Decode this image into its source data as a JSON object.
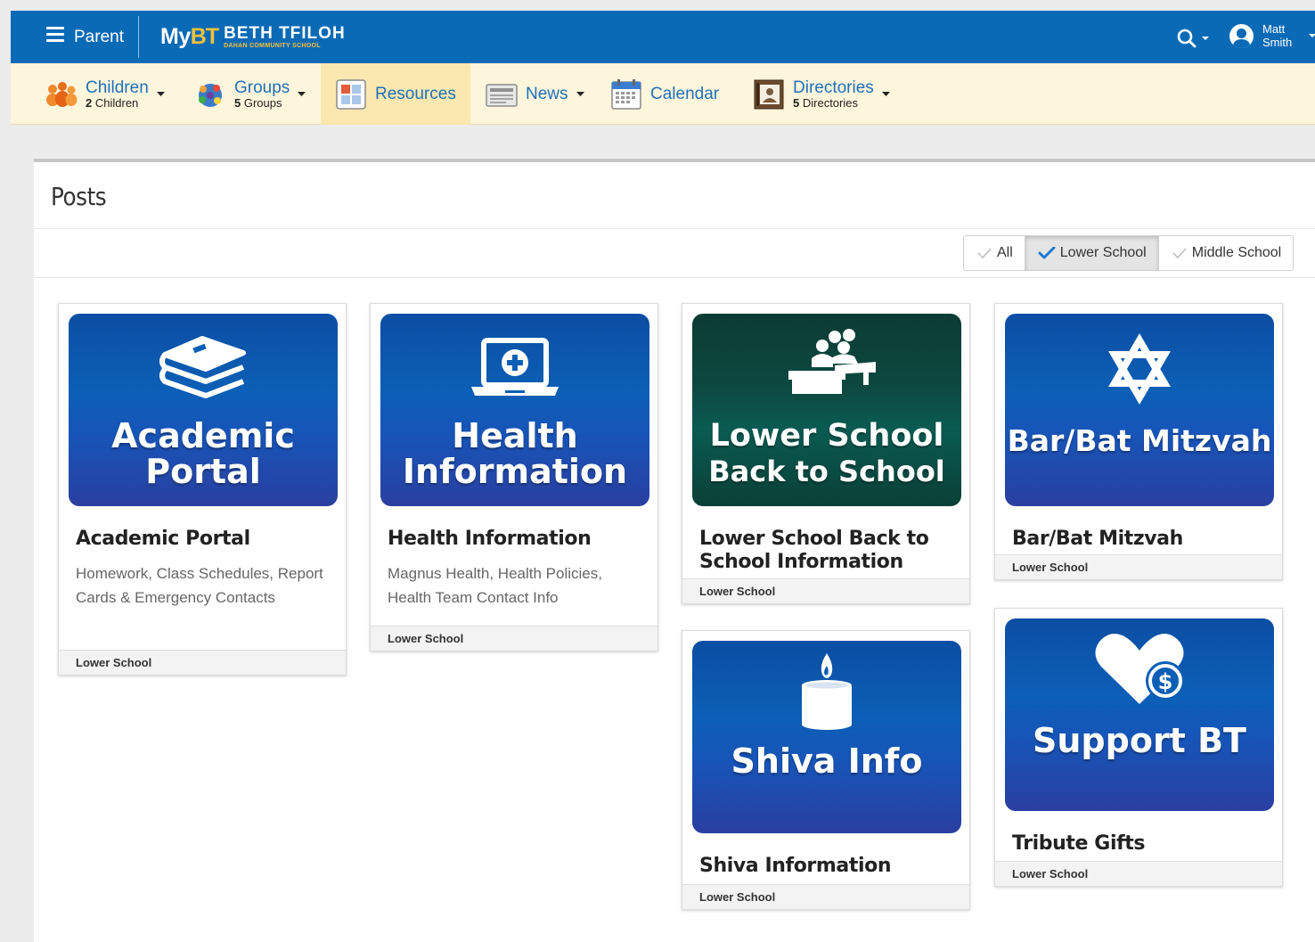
{
  "header": {
    "role": "Parent",
    "logo_prefix": "My",
    "logo_bt": "BT",
    "school_name": "BETH TFILOH",
    "school_sub": "DAHAN COMMUNITY SCHOOL",
    "user_first": "Matt",
    "user_last": "Smith"
  },
  "nav": {
    "children": {
      "label": "Children",
      "count": "2",
      "sub": "Children"
    },
    "groups": {
      "label": "Groups",
      "count": "5",
      "sub": "Groups"
    },
    "resources": {
      "label": "Resources"
    },
    "news": {
      "label": "News"
    },
    "calendar": {
      "label": "Calendar"
    },
    "directories": {
      "label": "Directories",
      "count": "5",
      "sub": "Directories"
    }
  },
  "page": {
    "title": "Posts"
  },
  "filters": {
    "all": "All",
    "lower": "Lower School",
    "middle": "Middle School",
    "selected": "Lower School"
  },
  "cards": [
    {
      "image_line1": "Academic",
      "image_line2": "Portal",
      "title": "Academic Portal",
      "description": "Homework, Class Schedules, Report Cards & Emergency Contacts",
      "tag": "Lower School",
      "icon": "books-icon"
    },
    {
      "image_line1": "Health",
      "image_line2": "Information",
      "title": "Health Information",
      "description": "Magnus Health, Health Policies, Health Team Contact Info",
      "tag": "Lower School",
      "icon": "laptop-plus-icon"
    },
    {
      "image_line1": "Lower School",
      "image_line2": "Back to School",
      "title_line1": "Lower School Back to",
      "title_line2": "School Information",
      "tag": "Lower School",
      "icon": "classroom-icon"
    },
    {
      "image_line1": "Bar/Bat Mitzvah",
      "title": "Bar/Bat Mitzvah",
      "tag": "Lower School",
      "icon": "star-of-david-icon"
    },
    {
      "image_line1": "Shiva Info",
      "title": "Shiva Information",
      "tag": "Lower School",
      "icon": "candle-icon"
    },
    {
      "image_line1": "Support BT",
      "title": "Tribute Gifts",
      "tag": "Lower School",
      "icon": "heart-dollar-icon"
    }
  ],
  "colors": {
    "header_blue": "#0a6ab6",
    "nav_bg": "#fdf5dc",
    "nav_active": "#fbe7b0",
    "link_blue": "#1f70b8",
    "logo_gold": "#f6c13b",
    "tile_blue": "#0c5fb6",
    "tile_green": "#0d4a42"
  }
}
